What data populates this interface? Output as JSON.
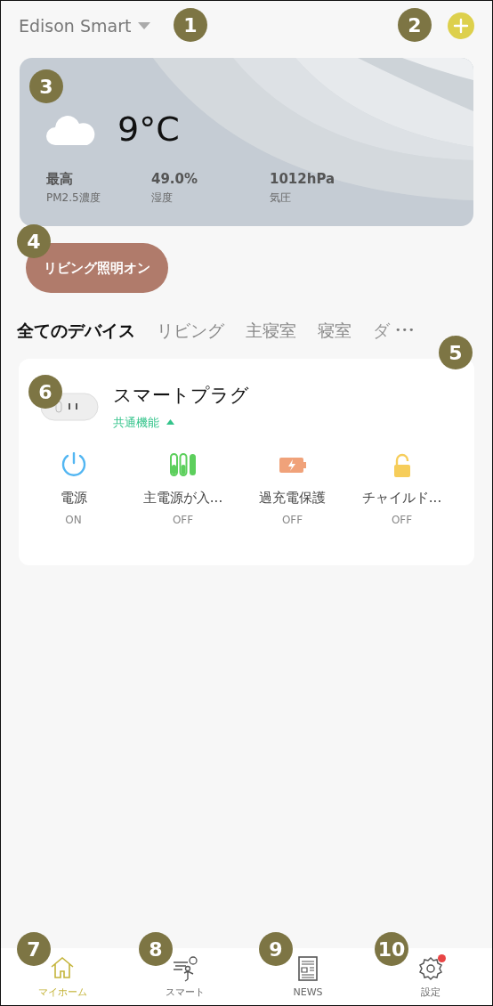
{
  "header": {
    "home_name": "Edison Smart"
  },
  "weather": {
    "temperature": "9°C",
    "stats": [
      {
        "value": "最高",
        "label": "PM2.5濃度"
      },
      {
        "value": "49.0%",
        "label": "湿度"
      },
      {
        "value": "1012hPa",
        "label": "気圧"
      }
    ]
  },
  "scenes": [
    {
      "label": "リビング照明オン"
    }
  ],
  "tabs": [
    {
      "label": "全てのデバイス",
      "selected": true
    },
    {
      "label": "リビング",
      "selected": false
    },
    {
      "label": "主寝室",
      "selected": false
    },
    {
      "label": "寝室",
      "selected": false
    },
    {
      "label": "ダ",
      "selected": false
    }
  ],
  "more_button": "•••",
  "device": {
    "name": "スマートプラグ",
    "section": "共通機能",
    "expanded": true,
    "functions": [
      {
        "kind": "power",
        "label": "電源",
        "value": "ON"
      },
      {
        "kind": "switches",
        "label": "主電源が入...",
        "value": "OFF"
      },
      {
        "kind": "battery",
        "label": "過充電保護",
        "value": "OFF"
      },
      {
        "kind": "lock",
        "label": "チャイルド...",
        "value": "OFF"
      }
    ]
  },
  "bottom_nav": [
    {
      "kind": "home",
      "label": "マイホーム",
      "selected": true,
      "badge": false
    },
    {
      "kind": "smart",
      "label": "スマート",
      "selected": false,
      "badge": false
    },
    {
      "kind": "news",
      "label": "NEWS",
      "selected": false,
      "badge": false
    },
    {
      "kind": "settings",
      "label": "設定",
      "selected": false,
      "badge": true
    }
  ],
  "callouts": [
    "1",
    "2",
    "3",
    "4",
    "5",
    "6",
    "7",
    "8",
    "9",
    "10"
  ]
}
